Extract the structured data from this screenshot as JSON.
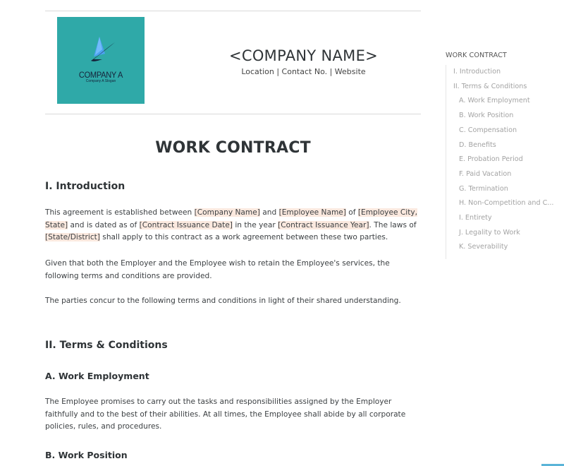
{
  "header": {
    "logo": {
      "name": "COMPANY A",
      "slogan": "Company A Slogan",
      "background_color": "#2fa9a8"
    },
    "company_name": "<COMPANY NAME>",
    "company_details": "Location | Contact No. | Website"
  },
  "document": {
    "title": "WORK CONTRACT",
    "sections": {
      "introduction": {
        "heading": "I. Introduction",
        "p1": {
          "t1": "This agreement is established between ",
          "f1": "[Company Name]",
          "t2": " and ",
          "f2": "[Employee Name]",
          "t3": " of ",
          "f3": "[Employee City, State]",
          "t4": " and is dated as of ",
          "f4": "[Contract Issuance Date]",
          "t5": " in the year ",
          "f5": "[Contract Issuance Year]",
          "t6": ". The laws of ",
          "f6": "[State/District]",
          "t7": " shall apply to this contract as a work agreement between these two parties."
        },
        "p2": "Given that both the Employer and the Employee wish to retain the Employee's services, the following terms and conditions are provided.",
        "p3": "The parties concur to the following terms and conditions in light of their shared understanding."
      },
      "terms": {
        "heading": "II. Terms & Conditions",
        "work_employment": {
          "heading": "A. Work Employment",
          "text": "The Employee promises to carry out the tasks and responsibilities assigned by the Employer faithfully and to the best of their abilities. At all times, the Employee shall abide by all corporate policies, rules, and procedures."
        },
        "work_position": {
          "heading": "B. Work Position"
        }
      }
    },
    "placeholder_highlight_color": "#fbe9df"
  },
  "toc": {
    "title": "WORK CONTRACT",
    "items": [
      {
        "label": "I. Introduction",
        "level": 1
      },
      {
        "label": "II. Terms & Conditions",
        "level": 1
      },
      {
        "label": "A. Work Employment",
        "level": 2
      },
      {
        "label": "B. Work Position",
        "level": 2
      },
      {
        "label": "C. Compensation",
        "level": 2
      },
      {
        "label": "D. Benefits",
        "level": 2
      },
      {
        "label": "E. Probation Period",
        "level": 2
      },
      {
        "label": "F. Paid Vacation",
        "level": 2
      },
      {
        "label": "G. Termination",
        "level": 2
      },
      {
        "label": "H. Non-Competition and C...",
        "level": 2
      },
      {
        "label": "I. Entirety",
        "level": 2
      },
      {
        "label": "J. Legality to Work",
        "level": 2
      },
      {
        "label": "K. Severability",
        "level": 2
      }
    ]
  }
}
